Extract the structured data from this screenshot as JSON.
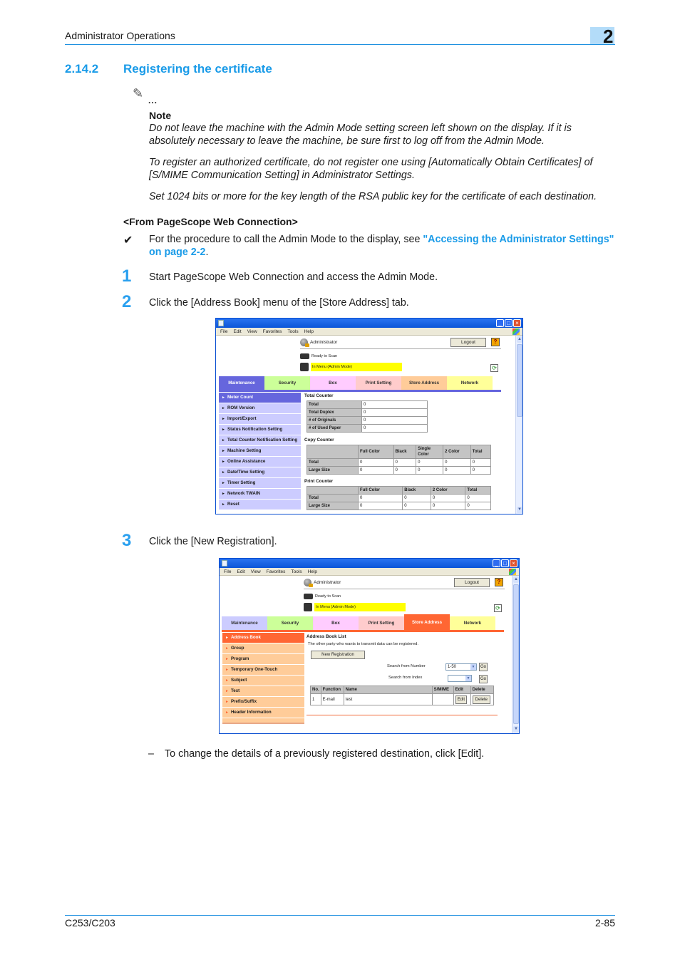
{
  "header": {
    "title": "Administrator Operations",
    "chapter": "2"
  },
  "section": {
    "number": "2.14.2",
    "title": "Registering the certificate"
  },
  "note": {
    "icon": "pencil-note-icon",
    "dots": "...",
    "label": "Note",
    "paragraphs": [
      "Do not leave the machine with the Admin Mode setting screen left shown on the display. If it is absolutely necessary to leave the machine, be sure first to log off from the Admin Mode.",
      "To register an authorized certificate, do not register one using [Automatically Obtain Certificates] of [S/MIME Communication Setting] in Administrator Settings.",
      "Set 1024 bits or more for the key length of the RSA public key for the certificate of each destination."
    ]
  },
  "procedure": {
    "heading": "<From PageScope Web Connection>",
    "prereq": {
      "mark": "✔",
      "text_before": "For the procedure to call the Admin Mode to the display, see ",
      "link_text": "\"Accessing the Administrator Settings\" on page 2-2",
      "text_after": "."
    },
    "steps": [
      {
        "num": "1",
        "text": "Start PageScope Web Connection and access the Admin Mode."
      },
      {
        "num": "2",
        "text": "Click the [Address Book] menu of the [Store Address] tab."
      },
      {
        "num": "3",
        "text": "Click the [New Registration]."
      }
    ],
    "sub_note": {
      "mark": "–",
      "text": "To change the details of a previously registered destination, click [Edit]."
    }
  },
  "browser": {
    "menu": [
      "File",
      "Edit",
      "View",
      "Favorites",
      "Tools",
      "Help"
    ],
    "user": "Administrator",
    "logout": "Logout",
    "help": "?",
    "status_ready": "Ready to Scan",
    "status_mode": "In Menu (Admin Mode)",
    "tabs": [
      {
        "label": "Maintenance",
        "color": "#ccccff",
        "active_color": "#6666dd"
      },
      {
        "label": "Security",
        "color": "#ccff99"
      },
      {
        "label": "Box",
        "color": "#ffccff"
      },
      {
        "label": "Print Setting",
        "color": "#ffcccc"
      },
      {
        "label": "Store Address",
        "color": "#ffcc99",
        "active_color": "#ff6633"
      },
      {
        "label": "Network",
        "color": "#ffff99"
      }
    ]
  },
  "screen1": {
    "side_menu": [
      "Meter Count",
      "ROM Version",
      "Import/Export",
      "Status Notification Setting",
      "Total Counter Notification Setting",
      "Machine Setting",
      "Online Assistance",
      "Date/Time Setting",
      "Timer Setting",
      "Network TWAIN",
      "Reset"
    ],
    "total_counter": {
      "title": "Total Counter",
      "rows": [
        [
          "Total",
          "0"
        ],
        [
          "Total Duplex",
          "0"
        ],
        [
          "# of Originals",
          "0"
        ],
        [
          "# of Used Paper",
          "0"
        ]
      ]
    },
    "copy_counter": {
      "title": "Copy Counter",
      "headers": [
        "",
        "Full Color",
        "Black",
        "Single Color",
        "2 Color",
        "Total"
      ],
      "rows": [
        [
          "Total",
          "0",
          "0",
          "0",
          "0",
          "0"
        ],
        [
          "Large Size",
          "0",
          "0",
          "0",
          "0",
          "0"
        ]
      ]
    },
    "print_counter": {
      "title": "Print Counter",
      "headers": [
        "",
        "Full Color",
        "Black",
        "2 Color",
        "Total"
      ],
      "rows": [
        [
          "Total",
          "0",
          "0",
          "0",
          "0"
        ],
        [
          "Large Size",
          "0",
          "0",
          "0",
          "0"
        ]
      ]
    }
  },
  "screen2": {
    "side_menu": [
      "Address Book",
      "Group",
      "Program",
      "Temporary One-Touch",
      "Subject",
      "Text",
      "Prefix/Suffix",
      "Header Information"
    ],
    "list_title": "Address Book List",
    "description": "The other party who wants to transmit data can be registered.",
    "new_registration": "New Registration",
    "search_number_label": "Search from Number",
    "search_number_value": "1-50",
    "search_index_label": "Search from Index",
    "search_index_value": "",
    "go": "Go",
    "table": {
      "headers": [
        "No.",
        "Function",
        "Name",
        "S/MIME",
        "Edit",
        "Delete"
      ],
      "rows": [
        {
          "no": "1",
          "function": "E-mail",
          "name": "test",
          "smime": "",
          "edit": "Edit",
          "delete": "Delete"
        }
      ]
    }
  },
  "footer": {
    "model": "C253/C203",
    "page": "2-85"
  }
}
